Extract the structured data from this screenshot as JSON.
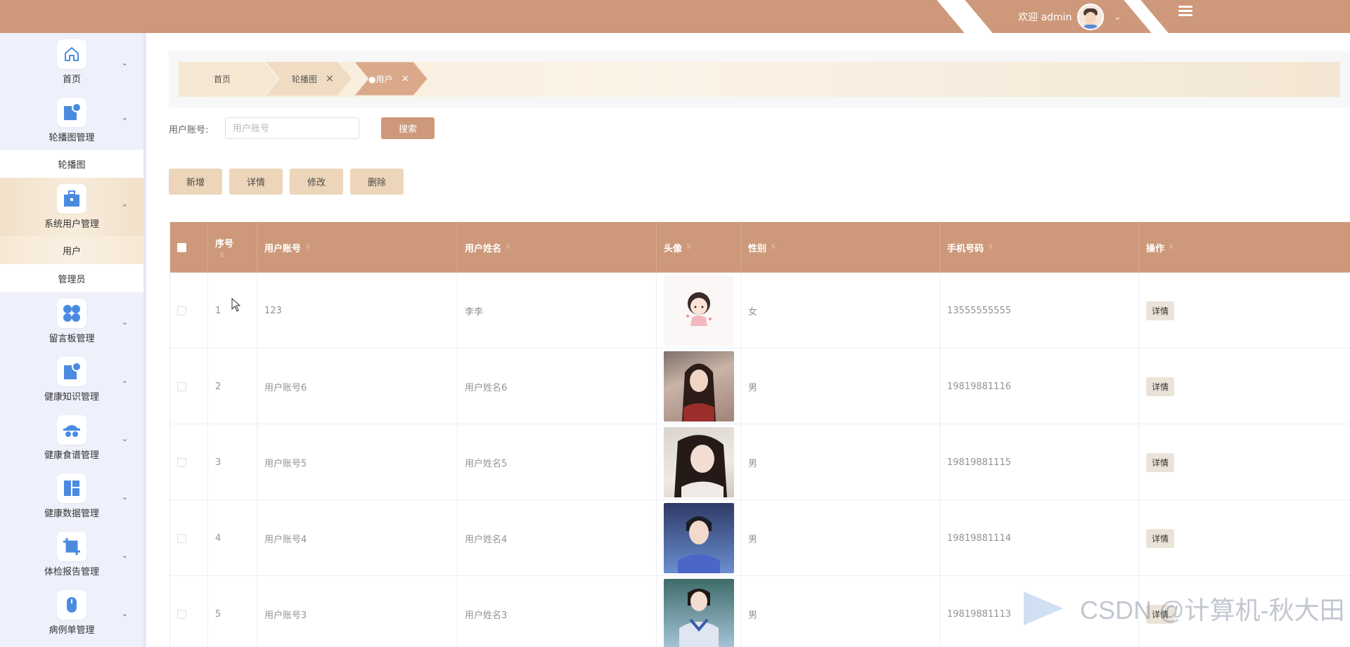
{
  "header": {
    "welcome": "欢迎 admin",
    "chevron": "⌄",
    "accent_color": "#cd997a"
  },
  "sidebar": {
    "items": [
      {
        "label": "首页",
        "icon": "home-icon",
        "arrow": "⌄"
      },
      {
        "label": "轮播图管理",
        "icon": "image-icon",
        "arrow": "⌃"
      },
      {
        "label": "系统用户管理",
        "icon": "briefcase-icon",
        "arrow": "⌃"
      },
      {
        "label": "留言板管理",
        "icon": "grid-icon",
        "arrow": "⌄"
      },
      {
        "label": "健康知识管理",
        "icon": "image-icon",
        "arrow": "⌄"
      },
      {
        "label": "健康食谱管理",
        "icon": "incognito-icon",
        "arrow": "⌄"
      },
      {
        "label": "健康数据管理",
        "icon": "dashboard-icon",
        "arrow": "⌄"
      },
      {
        "label": "体检报告管理",
        "icon": "crop-icon",
        "arrow": "⌄"
      },
      {
        "label": "病例单管理",
        "icon": "mouse-icon",
        "arrow": "⌄"
      }
    ],
    "sub_carousel": "轮播图",
    "sub_user": "用户",
    "sub_admin": "管理员"
  },
  "tabs": [
    {
      "label": "首页"
    },
    {
      "label": "轮播图",
      "close": "×"
    },
    {
      "label": "●用户",
      "close": "×"
    }
  ],
  "search": {
    "label": "用户账号:",
    "placeholder": "用户账号",
    "button": "搜索"
  },
  "actions": {
    "add": "新增",
    "detail": "详情",
    "edit": "修改",
    "delete": "删除"
  },
  "table": {
    "headers": {
      "index": "序号",
      "account": "用户账号",
      "name": "用户姓名",
      "avatar": "头像",
      "gender": "性别",
      "phone": "手机号码",
      "ops": "操作"
    },
    "sort_glyph": "⇅",
    "row_button": "详情",
    "rows": [
      {
        "index": "1",
        "account": "123",
        "name": "李李",
        "gender": "女",
        "phone": "13555555555"
      },
      {
        "index": "2",
        "account": "用户账号6",
        "name": "用户姓名6",
        "gender": "男",
        "phone": "19819881116"
      },
      {
        "index": "3",
        "account": "用户账号5",
        "name": "用户姓名5",
        "gender": "男",
        "phone": "19819881115"
      },
      {
        "index": "4",
        "account": "用户账号4",
        "name": "用户姓名4",
        "gender": "男",
        "phone": "19819881114"
      },
      {
        "index": "5",
        "account": "用户账号3",
        "name": "用户姓名3",
        "gender": "男",
        "phone": "19819881113"
      }
    ]
  },
  "watermark": "CSDN @计算机-秋大田"
}
